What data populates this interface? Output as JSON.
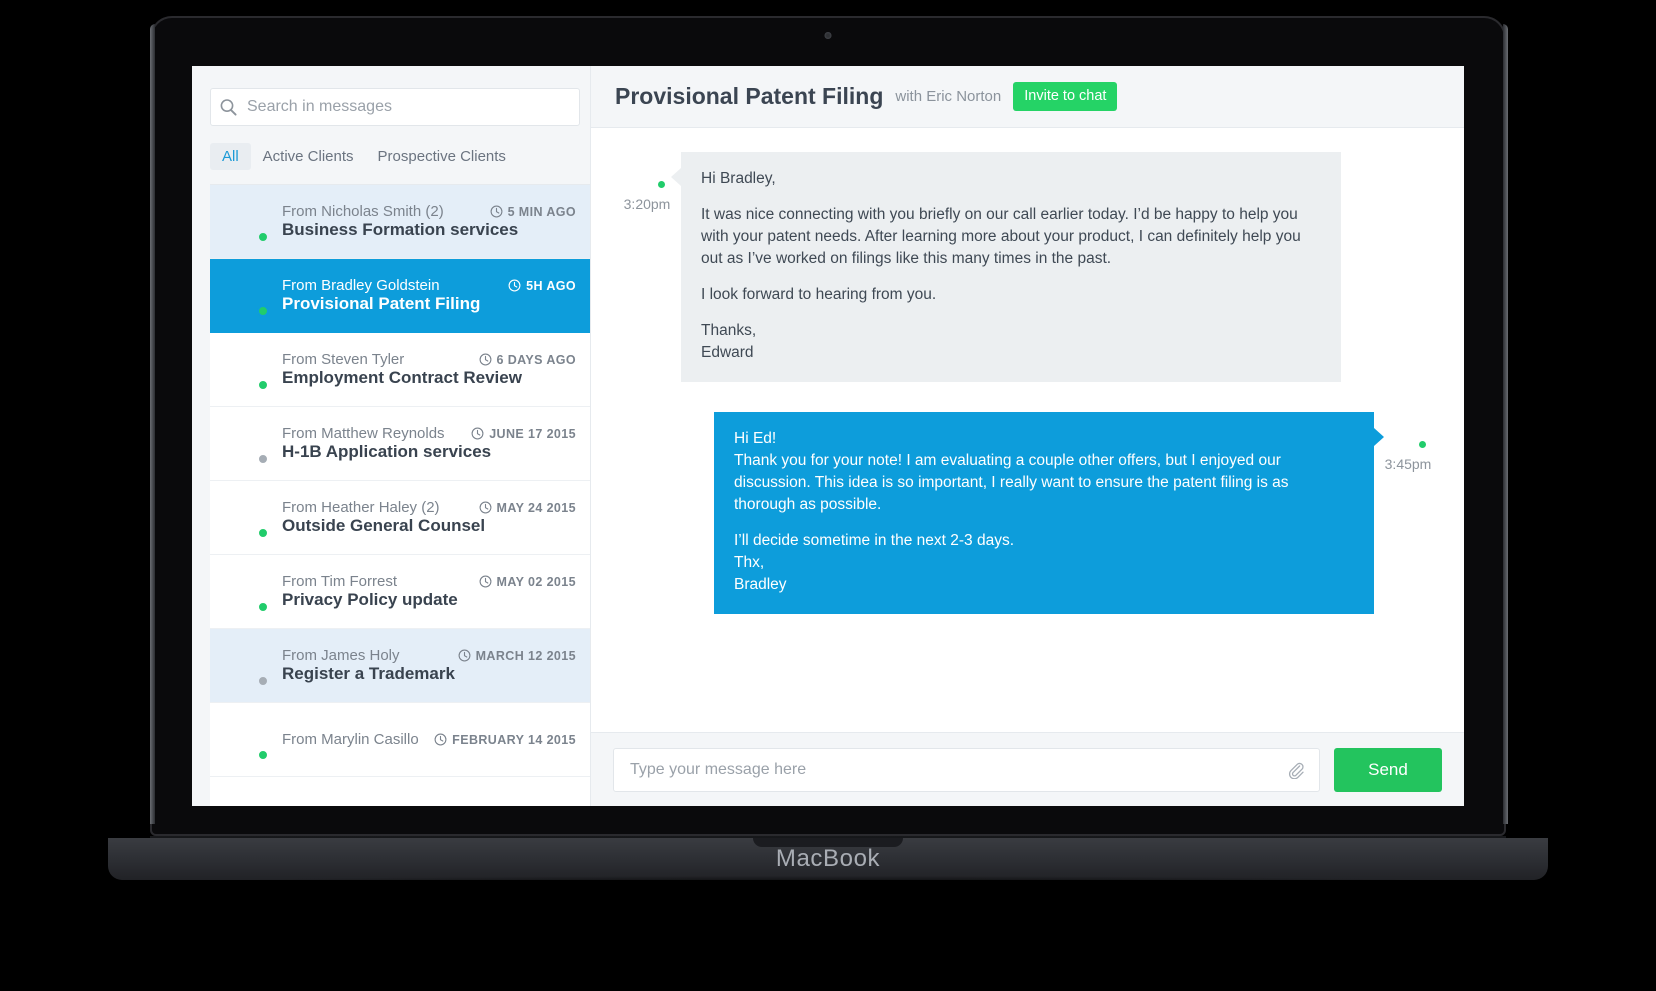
{
  "device": {
    "label": "MacBook"
  },
  "sidebar": {
    "search": {
      "placeholder": "Search in messages",
      "value": "",
      "icon": "search-icon"
    },
    "tabs": [
      {
        "label": "All",
        "active": true
      },
      {
        "label": "Active Clients",
        "active": false
      },
      {
        "label": "Prospective Clients",
        "active": false
      }
    ],
    "conversations": [
      {
        "from": "From Nicholas Smith (2)",
        "time": "5 MIN AGO",
        "subject": "Business Formation services",
        "state": "unread",
        "presence": "online",
        "avatar": {
          "skin": "#d79a76",
          "hair": "#4a2d1d",
          "bg": "#e7962c",
          "shirt": "#2e3a46"
        }
      },
      {
        "from": "From Bradley Goldstein",
        "time": "5H AGO",
        "subject": "Provisional Patent Filing",
        "state": "selected",
        "presence": "online",
        "avatar": {
          "skin": "#cf9e82",
          "hair": "#2b2623",
          "bg": "#9ba3aa",
          "shirt": "#c3cace"
        }
      },
      {
        "from": "From Steven Tyler",
        "time": "6 DAYS AGO",
        "subject": "Employment Contract Review",
        "state": "normal",
        "presence": "online",
        "avatar": {
          "skin": "#b9937c",
          "hair": "#21201f",
          "bg": "#8d9499",
          "shirt": "#4b5158"
        }
      },
      {
        "from": "From Matthew Reynolds",
        "time": "JUNE 17 2015",
        "subject": "H-1B Application services",
        "state": "normal",
        "presence": "offline",
        "avatar": {
          "skin": "#c8997c",
          "hair": "#2f2a26",
          "bg": "#7fa9c4",
          "shirt": "#2d5a7a"
        }
      },
      {
        "from": "From Heather Haley (2)",
        "time": "MAY 24 2015",
        "subject": "Outside General Counsel",
        "state": "normal",
        "presence": "online",
        "avatar": {
          "skin": "#d6a98c",
          "hair": "#3a2418",
          "bg": "#9aa2a8",
          "shirt": "#6a5a4c"
        }
      },
      {
        "from": "From Tim Forrest",
        "time": "MAY 02 2015",
        "subject": "Privacy Policy update",
        "state": "normal",
        "presence": "online",
        "avatar": {
          "skin": "#d3a082",
          "hair": "#6b3f22",
          "bg": "#9aa3a9",
          "shirt": "#b9cfdd"
        }
      },
      {
        "from": "From James Holy",
        "time": "MARCH 12 2015",
        "subject": "Register a Trademark",
        "state": "unread",
        "presence": "offline",
        "avatar": {
          "skin": "#dda884",
          "hair": "#b4561f",
          "bg": "#8e4423",
          "shirt": "#7a3a1c"
        }
      },
      {
        "from": "From Marylin Casillo",
        "time": "FEBRUARY 14 2015",
        "subject": "",
        "state": "normal",
        "presence": "online",
        "avatar": {
          "skin": "#e0b394",
          "hair": "#171716",
          "bg": "#c9cdd1",
          "shirt": "#20222a"
        }
      }
    ]
  },
  "chat": {
    "title": "Provisional Patent Filing",
    "with": "with Eric Norton",
    "invite_label": "Invite to chat",
    "messages": [
      {
        "direction": "incoming",
        "time": "3:20pm",
        "presence": "online",
        "avatar": {
          "skin": "#e2b193",
          "hair": "#6d4c2f",
          "bg": "#7fa24f",
          "shirt": "#2f4a63"
        },
        "paragraphs": [
          "Hi Bradley,",
          "It was nice connecting with you briefly on our call earlier today. I’d be happy to help you with your patent needs. After learning more about your product, I can definitely help you out as I’ve worked on filings like this many times in the past.",
          "I look forward to hearing from you.",
          "Thanks,\nEdward"
        ]
      },
      {
        "direction": "outgoing",
        "time": "3:45pm",
        "presence": "online",
        "avatar": {
          "skin": "#cf9e82",
          "hair": "#2b2623",
          "bg": "#9ba3aa",
          "shirt": "#c3cace"
        },
        "paragraphs": [
          "Hi Ed!\nThank you for your note! I am evaluating a couple other offers, but I enjoyed our discussion. This idea is so important, I really want to ensure the patent filing is as thorough as possible.",
          "I’ll decide sometime in the next 2-3 days.\nThx,\nBradley"
        ]
      }
    ],
    "compose": {
      "placeholder": "Type your message here",
      "value": "",
      "attach_icon": "paperclip-icon",
      "send_label": "Send"
    }
  },
  "colors": {
    "accent_blue": "#0d9ddb",
    "accent_green": "#23c45e",
    "invite_green": "#25d366",
    "online": "#21cc6b",
    "offline": "#a6adb5",
    "unread_row": "#e4eef8",
    "app_bg": "#f4f6f8"
  }
}
